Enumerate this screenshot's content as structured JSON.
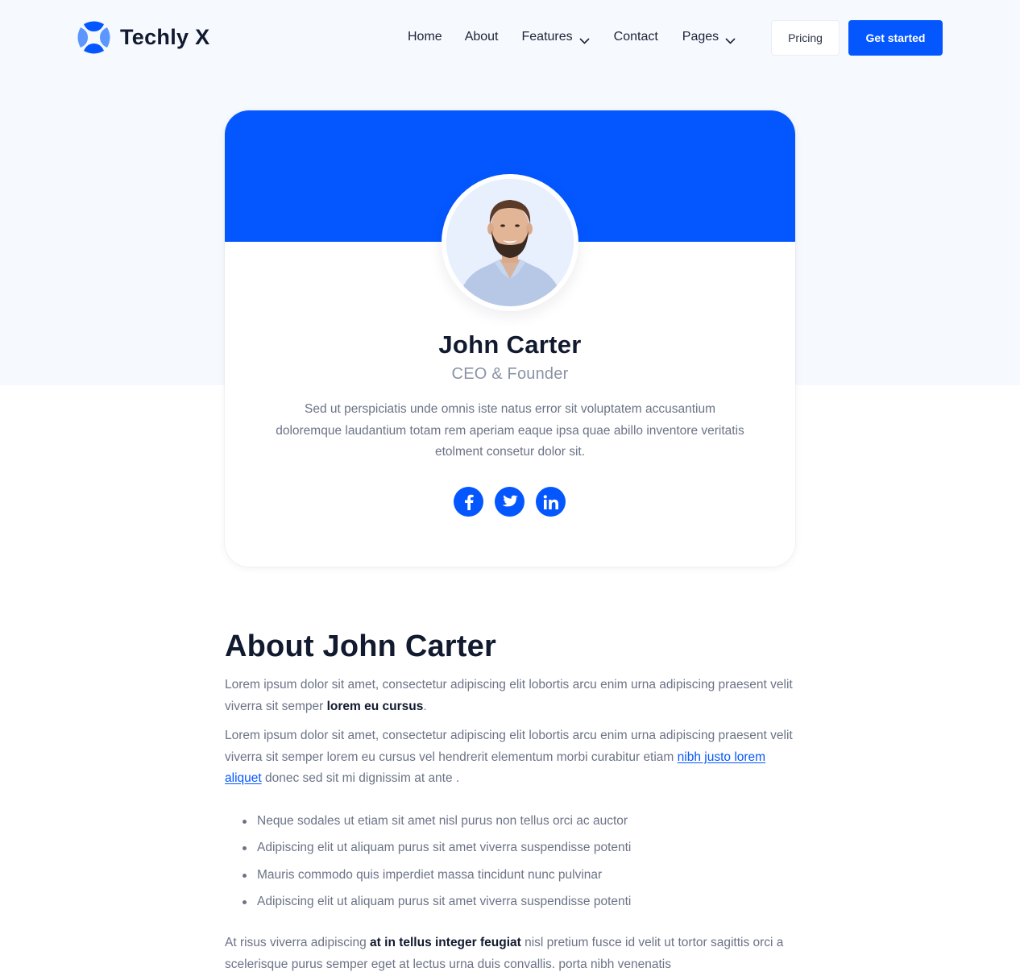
{
  "header": {
    "brand": "Techly X",
    "nav": [
      {
        "label": "Home",
        "dropdown": false
      },
      {
        "label": "About",
        "dropdown": false
      },
      {
        "label": "Features",
        "dropdown": true
      },
      {
        "label": "Contact",
        "dropdown": false
      },
      {
        "label": "Pages",
        "dropdown": true
      }
    ],
    "pricing_label": "Pricing",
    "cta_label": "Get started"
  },
  "profile": {
    "name": "John Carter",
    "role": "CEO & Founder",
    "bio": "Sed ut perspiciatis unde omnis iste natus error sit voluptatem accusantium doloremque laudantium totam rem aperiam eaque ipsa quae abillo inventore veritatis etolment consetur dolor sit.",
    "socials": [
      {
        "name": "facebook",
        "icon": "facebook-icon"
      },
      {
        "name": "twitter",
        "icon": "twitter-icon"
      },
      {
        "name": "linkedin",
        "icon": "linkedin-icon"
      }
    ]
  },
  "about": {
    "title": "About John Carter",
    "p1_text": "Lorem ipsum dolor sit amet, consectetur adipiscing elit lobortis arcu enim urna adipiscing praesent velit viverra sit semper ",
    "p1_bold": "lorem eu cursus",
    "p1_end": ".",
    "p2_text": "Lorem ipsum dolor sit amet, consectetur adipiscing elit lobortis arcu enim urna adipiscing praesent velit viverra sit semper lorem eu cursus vel hendrerit elementum morbi curabitur etiam ",
    "p2_link": "nibh justo lorem aliquet",
    "p2_end": " donec sed sit mi dignissim at ante .",
    "bullets": [
      "Neque sodales ut etiam sit amet nisl purus non tellus orci ac auctor",
      "Adipiscing elit ut aliquam purus sit amet viverra suspendisse potenti",
      "Mauris commodo quis imperdiet massa tincidunt nunc pulvinar",
      "Adipiscing elit ut aliquam purus sit amet viverra suspendisse potenti"
    ],
    "p3_text": "At risus viverra adipiscing ",
    "p3_bold": "at in tellus integer feugiat",
    "p3_end": " nisl pretium fusce id velit ut tortor sagittis orci a scelerisque purus semper eget at lectus urna duis convallis. porta nibh venenatis"
  },
  "colors": {
    "accent": "#0457ff",
    "heading": "#111a2e",
    "body": "#6b7386",
    "hero_bg": "#f6f9fe"
  }
}
